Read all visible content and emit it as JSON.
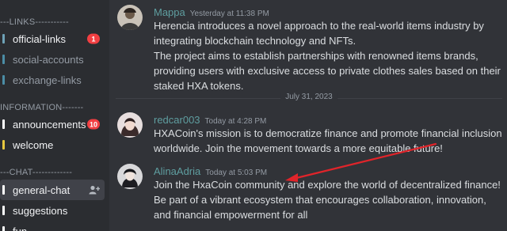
{
  "sidebar": {
    "categories": {
      "links": "---LINKS-----------",
      "information": "INFORMATION-------",
      "chat": "---CHAT-------------"
    },
    "channels": [
      {
        "label": "official-links",
        "badge": "1",
        "icon_color": "#6ea2b7"
      },
      {
        "label": "social-accounts",
        "icon_color": "#4b8da6"
      },
      {
        "label": "exchange-links",
        "icon_color": "#4b8da6"
      },
      {
        "label": "announcements",
        "badge": "10",
        "icon_color": "#ffffff"
      },
      {
        "label": "welcome",
        "icon_color": "#e7c83f"
      },
      {
        "label": "general-chat",
        "icon_color": "#ffffff"
      },
      {
        "label": "suggestions",
        "icon_color": "#ffffff"
      },
      {
        "label": "fun",
        "icon_color": "#ffffff"
      }
    ]
  },
  "messages": [
    {
      "author": "Mappa",
      "author_color": "#5f9ea0",
      "timestamp": "Yesterday at 11:38 PM",
      "lines": [
        "Herencia introduces a novel approach to the real-world items industry by integrating blockchain technology and NFTs.",
        "The project aims to establish partnerships with renowned items brands, providing users with exclusive access to private clothes sales based on their staked HXA tokens."
      ]
    },
    {
      "author": "redcar003",
      "author_color": "#5f9ea0",
      "timestamp": "Today at 4:28 PM",
      "lines": [
        "HXACoin's mission is to democratize finance and promote financial inclusion worldwide. Join the movement towards a more equitable future!"
      ]
    },
    {
      "author": "AlinaAdria",
      "author_color": "#5f9ea0",
      "timestamp": "Today at 5:03 PM",
      "lines": [
        "Join the HxaCoin community and explore the world of decentralized finance! Be part of a vibrant ecosystem that encourages collaboration, innovation, and financial empowerment for all"
      ]
    }
  ],
  "date_divider": "July 31, 2023",
  "colors": {
    "annotation_arrow": "#e0242a",
    "badge": "#f23f42"
  }
}
